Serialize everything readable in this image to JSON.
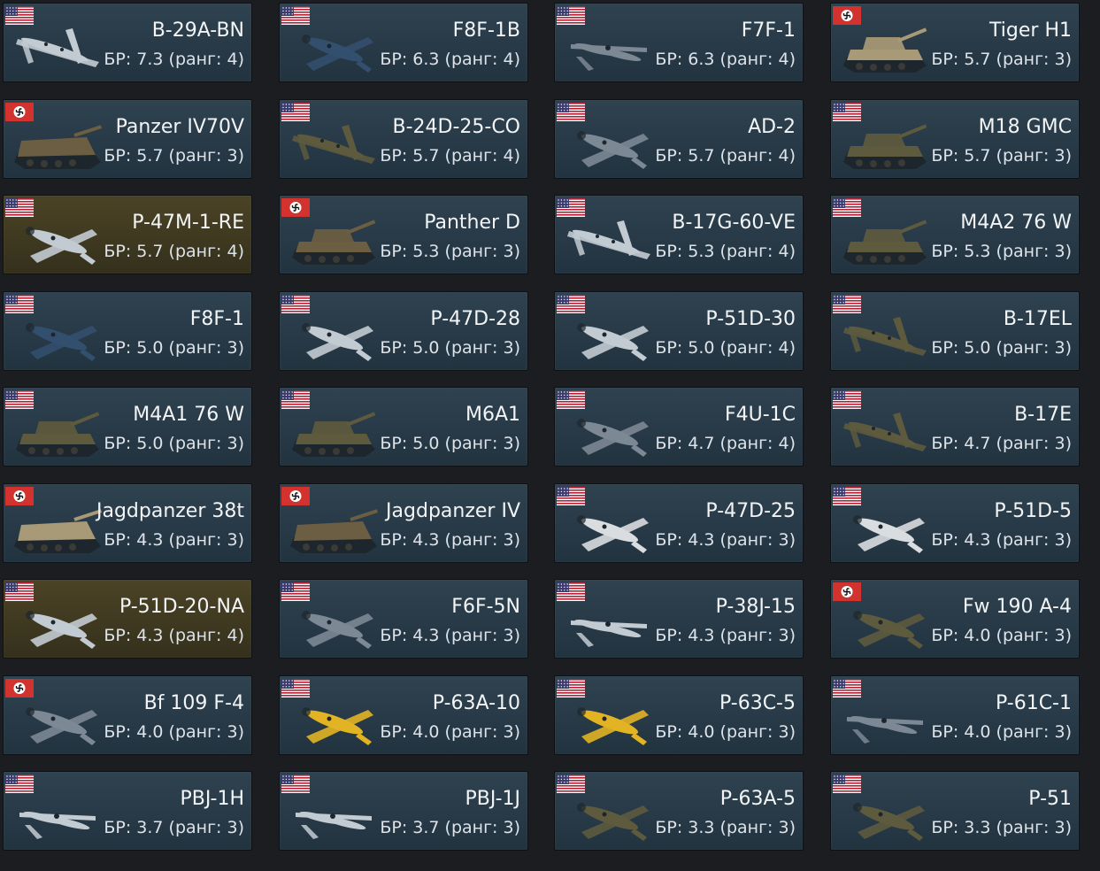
{
  "br_prefix": "БР: ",
  "rank_word": "ранг: ",
  "flag_colors": {
    "usa": "#b22234",
    "germany": "#d3332e"
  },
  "tint_colors": {
    "navy": "#334f6e",
    "silver": "#c3cbd2",
    "gray": "#7c8894",
    "olive": "#5d5a3e",
    "tan": "#a89a76",
    "yellow": "#e2b423",
    "camo": "#6c5e42",
    "stripes": "#d9dde0"
  },
  "vehicles": [
    {
      "name": "B-29A-BN",
      "br": "7.3",
      "rank": "4",
      "nation": "usa",
      "kind": "bomber",
      "tint": "silver",
      "premium": false
    },
    {
      "name": "F8F-1B",
      "br": "6.3",
      "rank": "4",
      "nation": "usa",
      "kind": "fighter",
      "tint": "navy",
      "premium": false
    },
    {
      "name": "F7F-1",
      "br": "6.3",
      "rank": "4",
      "nation": "usa",
      "kind": "twin",
      "tint": "gray",
      "premium": false
    },
    {
      "name": "Tiger H1",
      "br": "5.7",
      "rank": "3",
      "nation": "germany",
      "kind": "tank",
      "tint": "tan",
      "premium": false
    },
    {
      "name": "Panzer IV70V",
      "br": "5.7",
      "rank": "3",
      "nation": "germany",
      "kind": "td",
      "tint": "camo",
      "premium": false
    },
    {
      "name": "B-24D-25-CO",
      "br": "5.7",
      "rank": "4",
      "nation": "usa",
      "kind": "bomber",
      "tint": "olive",
      "premium": false
    },
    {
      "name": "AD-2",
      "br": "5.7",
      "rank": "4",
      "nation": "usa",
      "kind": "fighter",
      "tint": "gray",
      "premium": false
    },
    {
      "name": "M18 GMC",
      "br": "5.7",
      "rank": "3",
      "nation": "usa",
      "kind": "tank",
      "tint": "olive",
      "premium": false
    },
    {
      "name": "P-47M-1-RE",
      "br": "5.7",
      "rank": "4",
      "nation": "usa",
      "kind": "fighter",
      "tint": "silver",
      "premium": true
    },
    {
      "name": "Panther D",
      "br": "5.3",
      "rank": "3",
      "nation": "germany",
      "kind": "tank",
      "tint": "camo",
      "premium": false
    },
    {
      "name": "B-17G-60-VE",
      "br": "5.3",
      "rank": "4",
      "nation": "usa",
      "kind": "bomber",
      "tint": "silver",
      "premium": false
    },
    {
      "name": "M4A2 76 W",
      "br": "5.3",
      "rank": "3",
      "nation": "usa",
      "kind": "tank",
      "tint": "olive",
      "premium": false
    },
    {
      "name": "F8F-1",
      "br": "5.0",
      "rank": "3",
      "nation": "usa",
      "kind": "fighter",
      "tint": "navy",
      "premium": false
    },
    {
      "name": "P-47D-28",
      "br": "5.0",
      "rank": "3",
      "nation": "usa",
      "kind": "fighter",
      "tint": "silver",
      "premium": false
    },
    {
      "name": "P-51D-30",
      "br": "5.0",
      "rank": "4",
      "nation": "usa",
      "kind": "fighter",
      "tint": "silver",
      "premium": false
    },
    {
      "name": "B-17EL",
      "br": "5.0",
      "rank": "3",
      "nation": "usa",
      "kind": "bomber",
      "tint": "olive",
      "premium": false
    },
    {
      "name": "M4A1 76 W",
      "br": "5.0",
      "rank": "3",
      "nation": "usa",
      "kind": "tank",
      "tint": "olive",
      "premium": false
    },
    {
      "name": "M6A1",
      "br": "5.0",
      "rank": "3",
      "nation": "usa",
      "kind": "tank",
      "tint": "olive",
      "premium": false
    },
    {
      "name": "F4U-1C",
      "br": "4.7",
      "rank": "4",
      "nation": "usa",
      "kind": "fighter",
      "tint": "gray",
      "premium": false
    },
    {
      "name": "B-17E",
      "br": "4.7",
      "rank": "3",
      "nation": "usa",
      "kind": "bomber",
      "tint": "olive",
      "premium": false
    },
    {
      "name": "Jagdpanzer 38t",
      "br": "4.3",
      "rank": "3",
      "nation": "germany",
      "kind": "td",
      "tint": "tan",
      "premium": false
    },
    {
      "name": "Jagdpanzer IV",
      "br": "4.3",
      "rank": "3",
      "nation": "germany",
      "kind": "td",
      "tint": "camo",
      "premium": false
    },
    {
      "name": "P-47D-25",
      "br": "4.3",
      "rank": "3",
      "nation": "usa",
      "kind": "fighter",
      "tint": "stripes",
      "premium": false
    },
    {
      "name": "P-51D-5",
      "br": "4.3",
      "rank": "3",
      "nation": "usa",
      "kind": "fighter",
      "tint": "stripes",
      "premium": false
    },
    {
      "name": "P-51D-20-NA",
      "br": "4.3",
      "rank": "4",
      "nation": "usa",
      "kind": "fighter",
      "tint": "silver",
      "premium": true
    },
    {
      "name": "F6F-5N",
      "br": "4.3",
      "rank": "3",
      "nation": "usa",
      "kind": "fighter",
      "tint": "gray",
      "premium": false
    },
    {
      "name": "P-38J-15",
      "br": "4.3",
      "rank": "3",
      "nation": "usa",
      "kind": "twin",
      "tint": "silver",
      "premium": false
    },
    {
      "name": "Fw 190 A-4",
      "br": "4.0",
      "rank": "3",
      "nation": "germany",
      "kind": "fighter",
      "tint": "olive",
      "premium": false
    },
    {
      "name": "Bf 109 F-4",
      "br": "4.0",
      "rank": "3",
      "nation": "germany",
      "kind": "fighter",
      "tint": "gray",
      "premium": false
    },
    {
      "name": "P-63A-10",
      "br": "4.0",
      "rank": "3",
      "nation": "usa",
      "kind": "fighter",
      "tint": "yellow",
      "premium": false
    },
    {
      "name": "P-63C-5",
      "br": "4.0",
      "rank": "3",
      "nation": "usa",
      "kind": "fighter",
      "tint": "yellow",
      "premium": false
    },
    {
      "name": "P-61C-1",
      "br": "4.0",
      "rank": "3",
      "nation": "usa",
      "kind": "twin",
      "tint": "gray",
      "premium": false
    },
    {
      "name": "PBJ-1H",
      "br": "3.7",
      "rank": "3",
      "nation": "usa",
      "kind": "twin",
      "tint": "silver",
      "premium": false
    },
    {
      "name": "PBJ-1J",
      "br": "3.7",
      "rank": "3",
      "nation": "usa",
      "kind": "twin",
      "tint": "silver",
      "premium": false
    },
    {
      "name": "P-63A-5",
      "br": "3.3",
      "rank": "3",
      "nation": "usa",
      "kind": "fighter",
      "tint": "olive",
      "premium": false
    },
    {
      "name": "P-51",
      "br": "3.3",
      "rank": "3",
      "nation": "usa",
      "kind": "fighter",
      "tint": "olive",
      "premium": false
    }
  ]
}
